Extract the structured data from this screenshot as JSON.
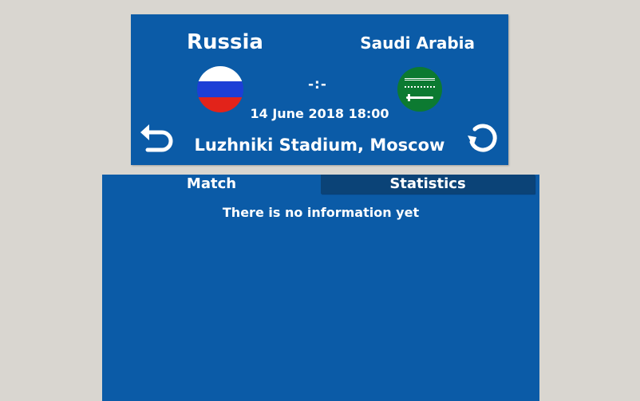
{
  "match": {
    "home_team": "Russia",
    "away_team": "Saudi Arabia",
    "score": "-:-",
    "datetime": "14 June 2018 18:00",
    "venue": "Luzhniki Stadium, Moscow"
  },
  "flags": {
    "home": {
      "name": "russia-flag-icon",
      "colors": [
        "#ffffff",
        "#1c3fd6",
        "#e2231a"
      ]
    },
    "away": {
      "name": "saudi-flag-icon",
      "colors": [
        "#0c7a31",
        "#ffffff"
      ]
    }
  },
  "icons": {
    "back": "undo-arrow-icon",
    "refresh": "refresh-icon"
  },
  "tabs": [
    {
      "label": "Match",
      "selected": true
    },
    {
      "label": "Statistics",
      "selected": false
    }
  ],
  "content": {
    "message": "There is no information yet"
  },
  "colors": {
    "background": "#d9d6d0",
    "panel": "#0b5ba7",
    "tab_inactive": "#0b4377",
    "text": "#ffffff"
  }
}
